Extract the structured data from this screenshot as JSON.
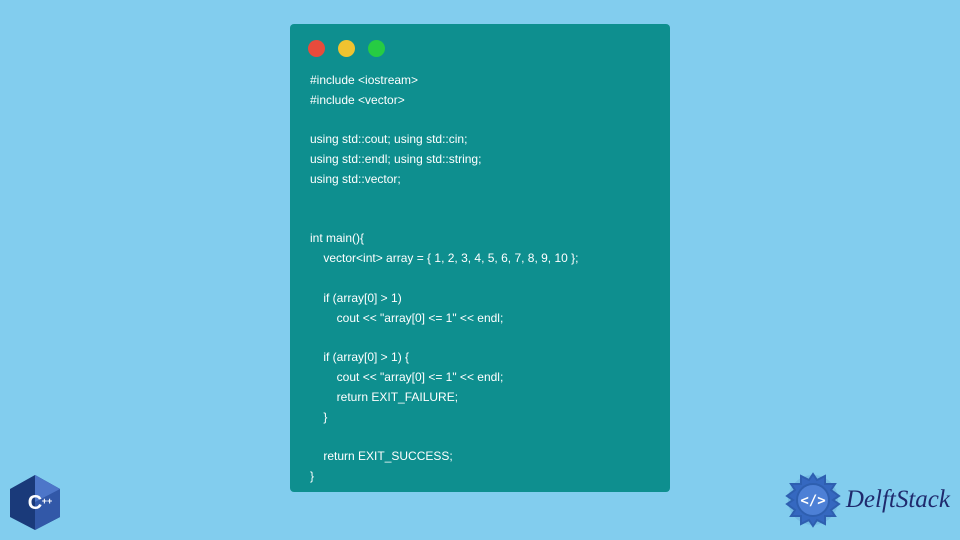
{
  "window": {
    "lights": [
      "red",
      "yellow",
      "green"
    ]
  },
  "code": {
    "lines": "#include <iostream>\n#include <vector>\n\nusing std::cout; using std::cin;\nusing std::endl; using std::string;\nusing std::vector;\n\n\nint main(){\n    vector<int> array = { 1, 2, 3, 4, 5, 6, 7, 8, 9, 10 };\n\n    if (array[0] > 1)\n        cout << \"array[0] <= 1\" << endl;\n\n    if (array[0] > 1) {\n        cout << \"array[0] <= 1\" << endl;\n        return EXIT_FAILURE;\n    }\n\n    return EXIT_SUCCESS;\n}"
  },
  "logos": {
    "cpp": "C++",
    "brand": "DelftStack"
  }
}
